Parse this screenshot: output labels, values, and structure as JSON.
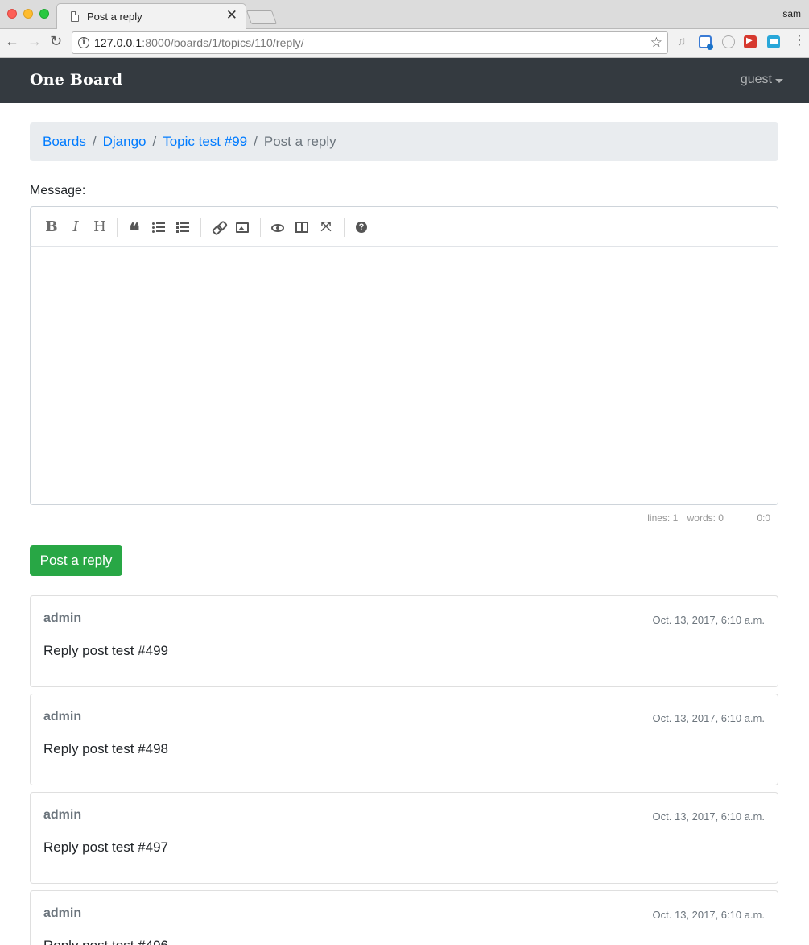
{
  "browser": {
    "tab_title": "Post a reply",
    "tab_close": "✕",
    "profile_name": "sam",
    "url_host": "127.0.0.1",
    "url_rest": ":8000/boards/1/topics/110/reply/",
    "info_icon": "i",
    "back_icon": "←",
    "forward_icon": "→",
    "reload_icon": "↻",
    "star_icon": "☆",
    "menu_icon": "⋮"
  },
  "navbar": {
    "brand": "One Board",
    "user": "guest"
  },
  "breadcrumb": {
    "items": [
      "Boards",
      "Django",
      "Topic test #99"
    ],
    "separator": "/",
    "active": "Post a reply"
  },
  "form": {
    "message_label": "Message:",
    "submit_label": "Post a reply",
    "editor_value": ""
  },
  "editor_toolbar": {
    "bold": "B",
    "italic": "I",
    "heading": "H",
    "quote": "❝",
    "fullscreen": "⤧",
    "help": "?"
  },
  "statusbar": {
    "lines": "lines: 1",
    "words": "words: 0",
    "cursor": "0:0"
  },
  "posts": [
    {
      "author": "admin",
      "date": "Oct. 13, 2017, 6:10 a.m.",
      "message": "Reply post test #499"
    },
    {
      "author": "admin",
      "date": "Oct. 13, 2017, 6:10 a.m.",
      "message": "Reply post test #498"
    },
    {
      "author": "admin",
      "date": "Oct. 13, 2017, 6:10 a.m.",
      "message": "Reply post test #497"
    },
    {
      "author": "admin",
      "date": "Oct. 13, 2017, 6:10 a.m.",
      "message": "Reply post test #496"
    }
  ],
  "colors": {
    "navbar_bg": "#343a40",
    "link": "#007bff",
    "success": "#28a745",
    "muted": "#6c757d",
    "breadcrumb_bg": "#e9ecef"
  }
}
